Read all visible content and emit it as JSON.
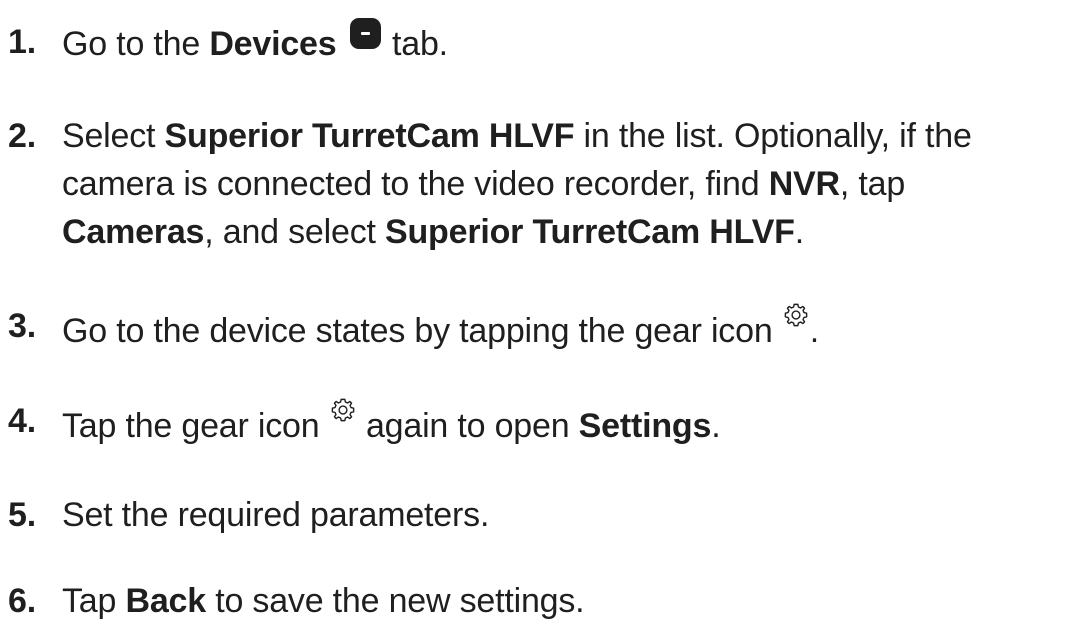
{
  "steps": [
    {
      "number": "1.",
      "t1": "Go to the ",
      "b1": "Devices",
      "t2": "tab.",
      "icon": "devices-tab-icon"
    },
    {
      "number": "2.",
      "line1_t1": "Select ",
      "line1_b1": "Superior TurretCam HLVF",
      "line1_t2": " in the list. Optionally, if the",
      "line2_t1": "camera is connected to the video recorder, find ",
      "line2_b1": "NVR",
      "line2_t2": ", tap",
      "line3_b1": "Cameras",
      "line3_t1": ", and select ",
      "line3_b2": "Superior TurretCam HLVF",
      "line3_t2": "."
    },
    {
      "number": "3.",
      "t1": "Go to the device states by tapping the gear icon ",
      "t2": ".",
      "icon": "gear-icon"
    },
    {
      "number": "4.",
      "t1": "Tap the gear icon ",
      "t2": " again to open ",
      "b1": "Settings",
      "t3": ".",
      "icon": "gear-icon"
    },
    {
      "number": "5.",
      "t1": "Set the required parameters."
    },
    {
      "number": "6.",
      "t1": "Tap ",
      "b1": "Back",
      "t2": " to save the new settings."
    }
  ],
  "colors": {
    "text": "#1f1f1f",
    "background": "#ffffff"
  }
}
